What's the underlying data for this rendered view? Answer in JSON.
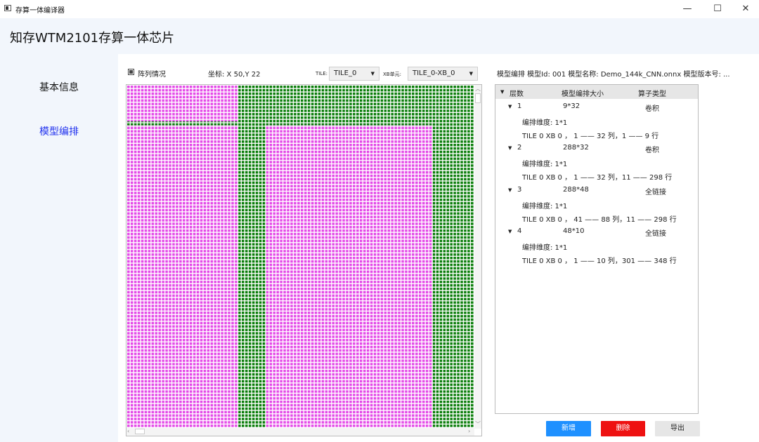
{
  "window": {
    "title": "存算一体编译器",
    "min_glyph": "—",
    "max_glyph": "☐",
    "close_glyph": "✕"
  },
  "header": {
    "title": "知存WTM2101存算一体芯片"
  },
  "sidebar": {
    "items": [
      {
        "label": "基本信息",
        "active": false
      },
      {
        "label": "模型编排",
        "active": true
      }
    ]
  },
  "toolbar": {
    "array_label": "阵列情况",
    "coord_text": "坐标:  X  50,Y  22",
    "tile_label": "TILE:",
    "tile_value": "TILE_0",
    "xb_label": "XB单元:",
    "xb_value": "TILE_0-XB_0"
  },
  "array_grid": {
    "columns": 100,
    "rows": 100,
    "colors": {
      "pink": "#e44be8",
      "green": "#0a7d0a",
      "gap": "#ffffff"
    },
    "regions": [
      {
        "layer": 1,
        "col_start": 1,
        "col_end": 32,
        "row_start": 1,
        "row_end": 9,
        "color": "#e44be8"
      },
      {
        "layer": 2,
        "col_start": 1,
        "col_end": 32,
        "row_start": 11,
        "row_end": 298,
        "color": "#e44be8"
      },
      {
        "layer": 3,
        "col_start": 41,
        "col_end": 88,
        "row_start": 11,
        "row_end": 298,
        "color": "#e44be8"
      }
    ]
  },
  "model_panel": {
    "info": "模型编排  模型Id: 001  模型名称: Demo_144k_CNN.onnx  模型版本号: ...",
    "headers": {
      "layer": "层数",
      "size": "模型编排大小",
      "op": "算子类型"
    },
    "layers": [
      {
        "num": "1",
        "size": "9*32",
        "op": "卷积",
        "dim": "编排维度: 1*1",
        "detail": "TILE 0   XB 0 ， 1 —— 32 列，1 —— 9 行"
      },
      {
        "num": "2",
        "size": "288*32",
        "op": "卷积",
        "dim": "编排维度: 1*1",
        "detail": "TILE 0   XB 0 ， 1 —— 32 列，11 —— 298 行"
      },
      {
        "num": "3",
        "size": "288*48",
        "op": "全链接",
        "dim": "编排维度: 1*1",
        "detail": "TILE 0   XB 0 ， 41 —— 88 列，11 —— 298 行"
      },
      {
        "num": "4",
        "size": "48*10",
        "op": "全链接",
        "dim": "编排维度: 1*1",
        "detail": "TILE 0   XB 0 ， 1 —— 10 列，301 —— 348 行"
      }
    ]
  },
  "actions": {
    "add": "新增",
    "delete": "删除",
    "export": "导出"
  },
  "colors": {
    "accent_blue": "#1e90ff",
    "danger_red": "#ee1111",
    "nav_active": "#2233ee"
  }
}
